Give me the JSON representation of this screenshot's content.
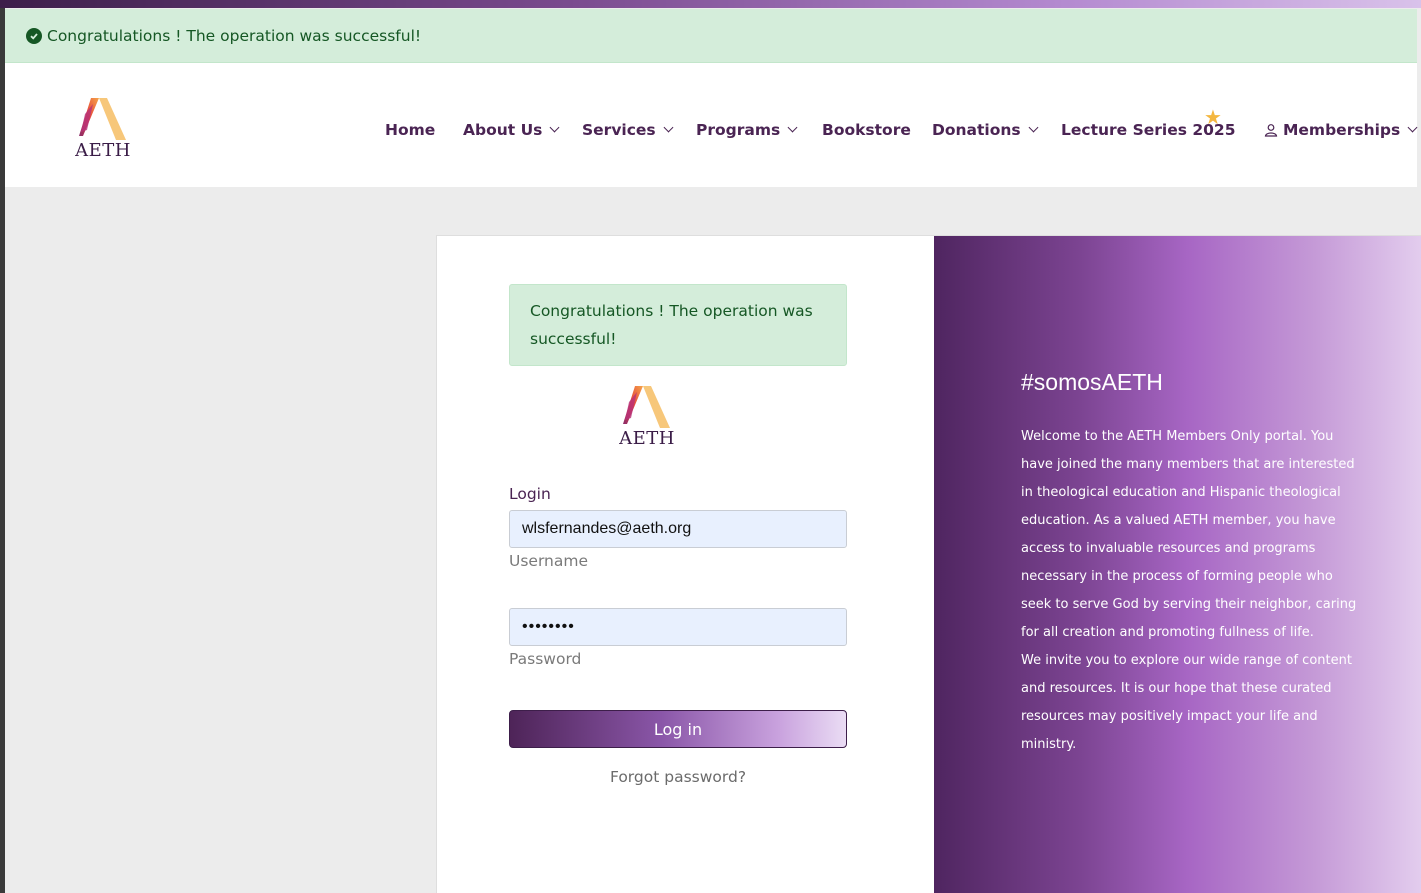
{
  "top_alert": {
    "message": "Congratulations ! The operation was successful!"
  },
  "header": {
    "logo_text": "AETH",
    "nav": [
      {
        "label": "Home",
        "has_dropdown": false
      },
      {
        "label": "About Us",
        "has_dropdown": true
      },
      {
        "label": "Services",
        "has_dropdown": true
      },
      {
        "label": "Programs",
        "has_dropdown": true
      },
      {
        "label": "Bookstore",
        "has_dropdown": false
      },
      {
        "label": "Donations",
        "has_dropdown": true
      },
      {
        "label": "Lecture Series 2025",
        "has_dropdown": false,
        "icon": "star-icon"
      },
      {
        "label": "Memberships",
        "has_dropdown": true,
        "icon": "person-icon"
      }
    ]
  },
  "login_form": {
    "alert": "Congratulations ! The operation was successful!",
    "logo_text": "AETH",
    "login_label": "Login",
    "username_value": "wlsfernandes@aeth.org",
    "username_helper": "Username",
    "password_value": "••••••••",
    "password_helper": "Password",
    "submit_label": "Log in",
    "forgot_label": "Forgot password?"
  },
  "promo": {
    "hashtag": "#somosAETH",
    "paragraph1": "Welcome to the AETH Members Only portal. You have joined the many members that are interested in theological education and Hispanic theological education. As a valued AETH member, you have access to invaluable resources and programs necessary in the process of forming people who seek to serve God by serving their neighbor, caring for all creation and promoting fullness of life.",
    "paragraph2": "We invite you to explore our wide range of content and resources. It is our hope that these curated resources may positively impact your life and ministry."
  },
  "colors": {
    "success_bg": "#d4edda",
    "success_text": "#155724",
    "brand_purple": "#4a2453",
    "star": "#f4b740"
  }
}
